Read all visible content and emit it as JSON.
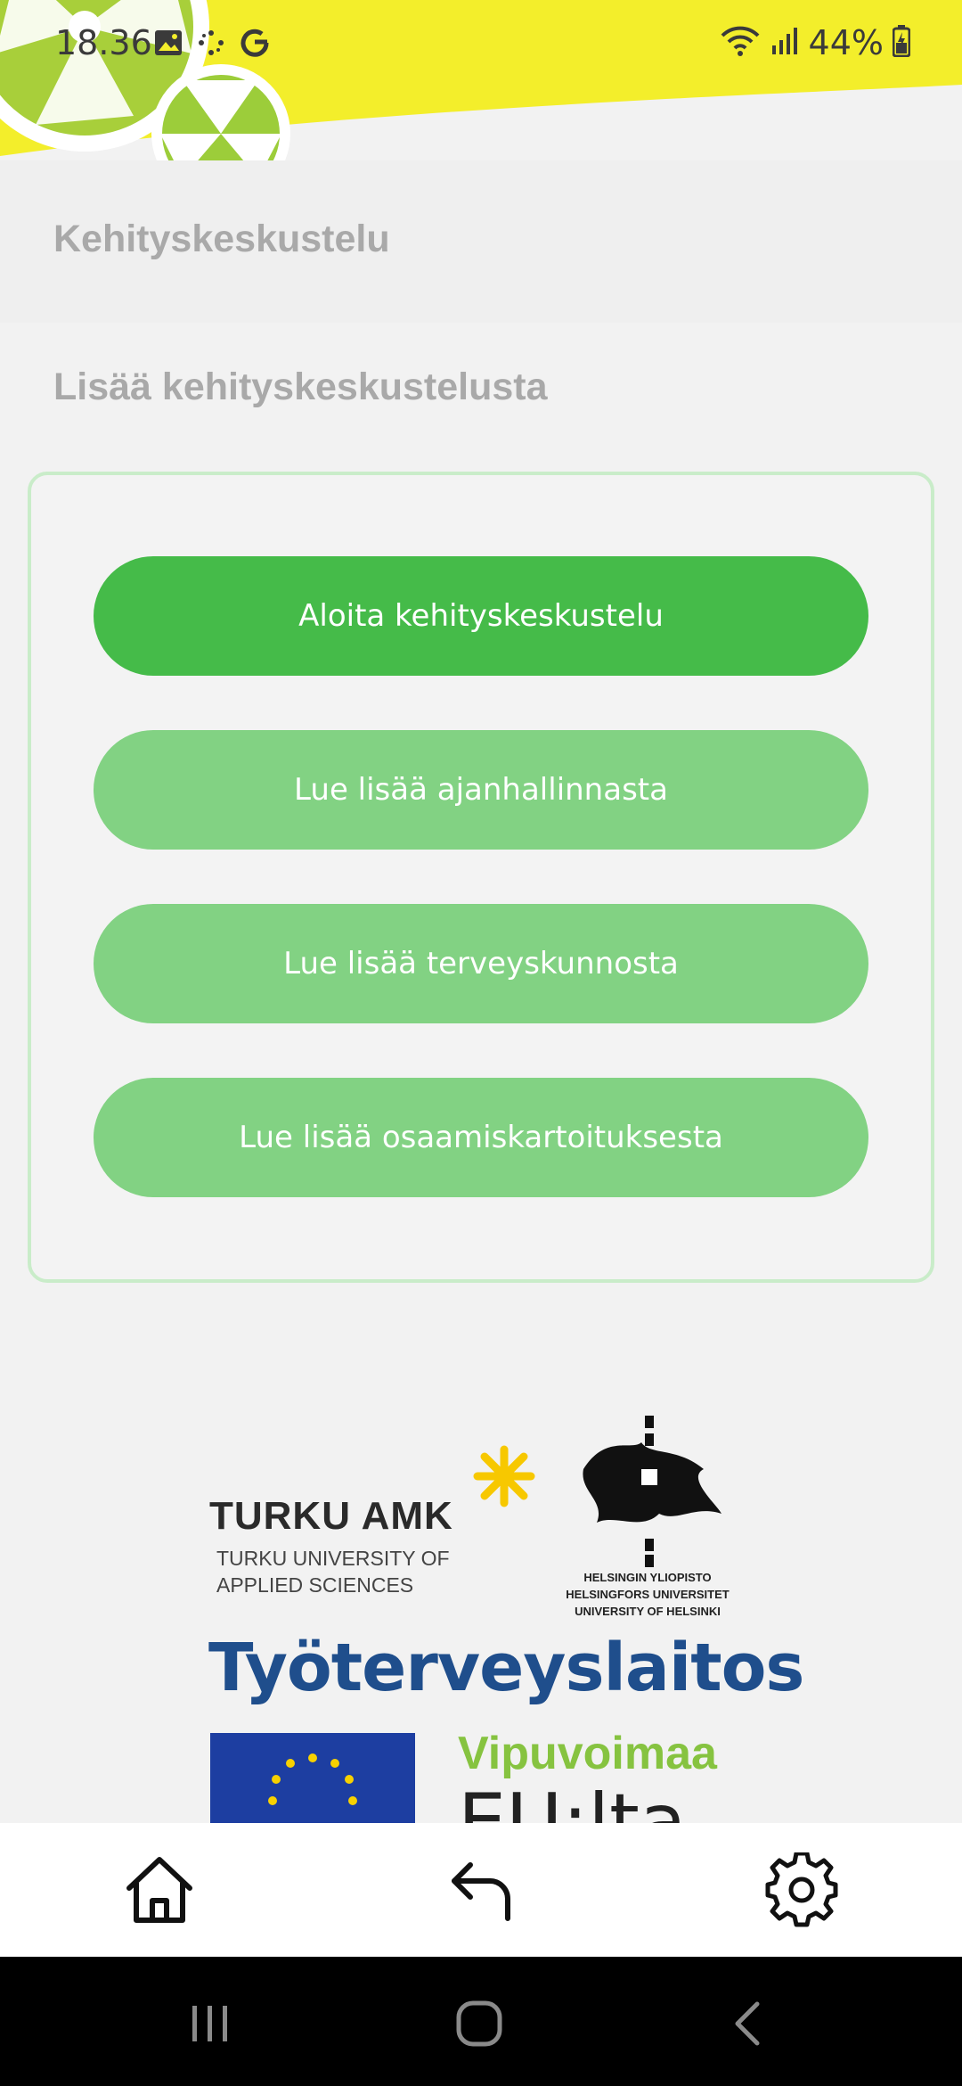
{
  "status_bar": {
    "time": "18.36",
    "battery": "44%",
    "icons": [
      "image-icon",
      "sparkle-icon",
      "google-icon",
      "wifi-icon",
      "signal-icon",
      "battery-icon"
    ]
  },
  "page": {
    "title": "Kehityskeskustelu",
    "section_title": "Lisää kehityskeskustelusta"
  },
  "buttons": [
    {
      "label": "Aloita kehityskeskustelu"
    },
    {
      "label": "Lue lisää ajanhallinnasta"
    },
    {
      "label": "Lue lisää terveyskunnosta"
    },
    {
      "label": "Lue lisää osaamiskartoituksesta"
    }
  ],
  "logos": {
    "turku_name": "TURKU AMK",
    "turku_sub": "TURKU UNIVERSITY OF APPLIED SCIENCES",
    "helsinki": "HELSINGIN YLIOPISTO HELSINGFORS UNIVERSITET UNIVERSITY OF HELSINKI",
    "ttl": "Työterveyslaitos",
    "vipuvoimaa": "Vipuvoimaa",
    "eu": "EU:lta"
  },
  "colors": {
    "primary": "#45bb49",
    "secondary": "#82d283",
    "header_yellow": "#f2ee2a",
    "title_gray": "#a9a9a9"
  },
  "bottom_nav": {
    "icons": [
      "home-icon",
      "back-arrow-icon",
      "settings-icon"
    ]
  },
  "system_nav": {
    "icons": [
      "recents-icon",
      "home-circle-icon",
      "chevron-left-icon"
    ]
  }
}
